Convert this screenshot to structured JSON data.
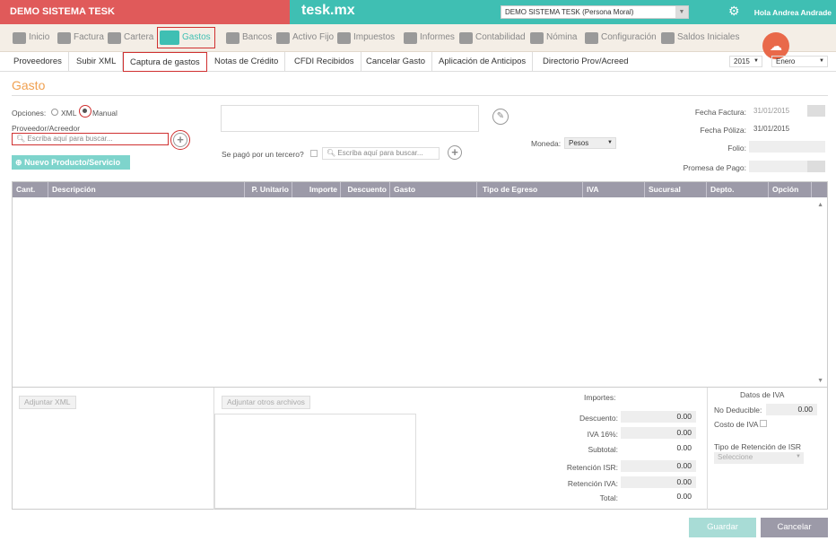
{
  "top": {
    "company_name": "DEMO SISTEMA TESK",
    "brand": "tesk.mx",
    "company_select": "DEMO SISTEMA TESK (Persona Moral)",
    "greeting": "Hola Andrea Andrade"
  },
  "main_nav": [
    {
      "label": "Inicio",
      "icon": "brain-icon"
    },
    {
      "label": "Factura",
      "icon": "tag-icon"
    },
    {
      "label": "Cartera",
      "icon": "wallet-icon"
    },
    {
      "label": "Gastos",
      "icon": "cart-icon"
    },
    {
      "label": "Bancos",
      "icon": "bank-icon"
    },
    {
      "label": "Activo Fijo",
      "icon": "house-icon"
    },
    {
      "label": "Impuestos",
      "icon": "briefcase-icon"
    },
    {
      "label": "Informes",
      "icon": "document-icon"
    },
    {
      "label": "Contabilidad",
      "icon": "calculator-icon"
    },
    {
      "label": "Nómina",
      "icon": "card-icon"
    },
    {
      "label": "Configuración",
      "icon": "wrench-icon"
    },
    {
      "label": "Saldos Iniciales",
      "icon": "ledger-icon"
    }
  ],
  "sub_nav": [
    "Proveedores",
    "Subir XML",
    "Captura de gastos",
    "Notas de Crédito",
    "CFDI Recibidos",
    "Cancelar Gasto",
    "Aplicación de Anticipos",
    "Directorio Prov/Acreed"
  ],
  "period": {
    "year": "2015",
    "month": "Enero"
  },
  "form": {
    "title": "Gasto",
    "options_label": "Opciones:",
    "option_xml": "XML",
    "option_manual": "Manual",
    "provider_label": "Proveedor/Acreedor",
    "search_placeholder": "Escriba aquí para buscar...",
    "new_product_button": "Nuevo Producto/Servicio",
    "third_party_label": "Se pagó por un tercero?",
    "currency_label": "Moneda:",
    "currency_value": "Pesos",
    "invoice_date_label": "Fecha Factura:",
    "invoice_date": "31/01/2015",
    "policy_date_label": "Fecha Póliza:",
    "policy_date": "31/01/2015",
    "folio_label": "Folio:",
    "payment_promise_label": "Promesa de Pago:"
  },
  "table": {
    "columns": [
      "Cant.",
      "Descripción",
      "P. Unitario",
      "Importe",
      "Descuento",
      "Gasto",
      "Tipo de Egreso",
      "IVA",
      "Sucursal",
      "Depto.",
      "Opción"
    ]
  },
  "bottom": {
    "attach_xml": "Adjuntar XML",
    "attach_other": "Adjuntar otros archivos",
    "importes_label": "Importes:",
    "totals": [
      {
        "label": "Descuento:",
        "value": "0.00",
        "boxed": true
      },
      {
        "label": "IVA 16%:",
        "value": "0.00",
        "boxed": true
      },
      {
        "label": "Subtotal:",
        "value": "0.00",
        "boxed": false
      },
      {
        "label": "Retención ISR:",
        "value": "0.00",
        "boxed": true
      },
      {
        "label": "Retención IVA:",
        "value": "0.00",
        "boxed": true
      },
      {
        "label": "Total:",
        "value": "0.00",
        "boxed": false
      }
    ],
    "iva_title": "Datos de IVA",
    "non_deductible_label": "No Deducible:",
    "non_deductible_value": "0.00",
    "iva_cost_label": "Costo de IVA",
    "isr_retention_label": "Tipo de Retención de ISR",
    "isr_select": "Seleccione"
  },
  "actions": {
    "save": "Guardar",
    "cancel": "Cancelar"
  }
}
